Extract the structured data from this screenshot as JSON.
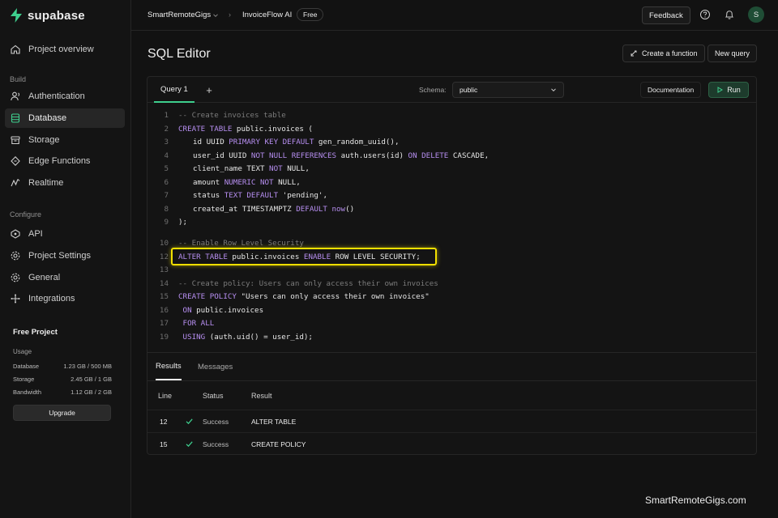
{
  "app": {
    "brand": "supabase",
    "colors": {
      "accent": "#3ecf8e",
      "highlight": "#f2e000",
      "keyword": "#b68ef0"
    }
  },
  "sidebar": {
    "top_item": {
      "label": "Project overview",
      "icon": "home-icon"
    },
    "build_section": "Build",
    "build_items": [
      {
        "label": "Authentication",
        "icon": "user-icon"
      },
      {
        "label": "Database",
        "icon": "database-icon",
        "active": true
      },
      {
        "label": "Storage",
        "icon": "archive-icon"
      },
      {
        "label": "Edge Functions",
        "icon": "code-icon"
      },
      {
        "label": "Realtime",
        "icon": "pulse-icon"
      }
    ],
    "configure_section": "Configure",
    "configure_items": [
      {
        "label": "API",
        "icon": "link-icon"
      },
      {
        "label": "Project Settings",
        "icon": "gear-icon"
      },
      {
        "label": "General",
        "icon": "settings-icon"
      },
      {
        "label": "Integrations",
        "icon": "puzzle-icon"
      }
    ],
    "usage": {
      "title": "Free Project",
      "label": "Usage",
      "rows": [
        {
          "name": "Database",
          "value": "1.23 GB / 500 MB"
        },
        {
          "name": "Storage",
          "value": "2.45 GB / 1 GB"
        },
        {
          "name": "Bandwidth",
          "value": "1.12 GB / 2 GB"
        }
      ],
      "upgrade_label": "Upgrade"
    }
  },
  "topbar": {
    "org": "SmartRemoteGigs",
    "project": "InvoiceFlow AI",
    "plan_badge": "Free",
    "feedback_label": "Feedback",
    "avatar_initial": "S"
  },
  "page": {
    "title": "SQL Editor",
    "create_function_label": "Create a function",
    "new_query_label": "New query"
  },
  "editor": {
    "tab_label": "Query 1",
    "add_tab_label": "+",
    "schema_label": "Schema:",
    "schema_value": "public",
    "documentation_label": "Documentation",
    "run_label": "Run",
    "lines": [
      {
        "n": "1",
        "tokens": [
          [
            "cm",
            "-- Create invoices table"
          ]
        ]
      },
      {
        "n": "2",
        "tokens": [
          [
            "kw",
            "CREATE TABLE"
          ],
          [
            "tx",
            " public.invoices ("
          ]
        ]
      },
      {
        "n": "3",
        "tokens": [
          [
            "tx",
            "  id UUID "
          ],
          [
            "kw",
            "PRIMARY KEY DEFAULT"
          ],
          [
            "tx",
            " gen_random_uuid(),"
          ]
        ]
      },
      {
        "n": "4",
        "tokens": [
          [
            "tx",
            "  user_id UUID "
          ],
          [
            "kw",
            "NOT NULL REFERENCES"
          ],
          [
            "tx",
            " auth.users(id) "
          ],
          [
            "kw",
            "ON DELETE"
          ],
          [
            "tx",
            " CASCADE,"
          ]
        ]
      },
      {
        "n": "5",
        "tokens": [
          [
            "tx",
            "  client_name TEXT "
          ],
          [
            "kw",
            "NOT"
          ],
          [
            "tx",
            " NULL,"
          ]
        ]
      },
      {
        "n": "6",
        "tokens": [
          [
            "tx",
            "  amount "
          ],
          [
            "kw",
            "NUMERIC NOT"
          ],
          [
            "tx",
            " NULL,"
          ]
        ]
      },
      {
        "n": "7",
        "tokens": [
          [
            "tx",
            "  status "
          ],
          [
            "kw",
            "TEXT DEFAULT"
          ],
          [
            "tx",
            " 'pending',"
          ]
        ]
      },
      {
        "n": "8",
        "tokens": [
          [
            "tx",
            "  created_at TIMESTAMPTZ "
          ],
          [
            "kw",
            "DEFAULT now"
          ],
          [
            "tx",
            "()"
          ]
        ]
      },
      {
        "n": "9",
        "tokens": [
          [
            "tx",
            ");"
          ]
        ]
      },
      {
        "n": "10",
        "tokens": [
          [
            "cm",
            "-- Enable Row Level Security"
          ]
        ]
      },
      {
        "n": "12",
        "tokens": [
          [
            "kw",
            "ALTER TABLE"
          ],
          [
            "tx",
            " public.invoices "
          ],
          [
            "kw",
            "ENABLE"
          ],
          [
            "tx",
            " ROW LEVEL SECURITY;"
          ]
        ],
        "highlighted": true
      },
      {
        "n": "13",
        "tokens": []
      },
      {
        "n": "14",
        "tokens": [
          [
            "cm",
            "-- Create policy: Users can only access their own invoices"
          ]
        ]
      },
      {
        "n": "15",
        "tokens": [
          [
            "kw",
            "CREATE POLICY"
          ],
          [
            "tx",
            " \"Users can only access their own invoices\""
          ]
        ]
      },
      {
        "n": "16",
        "tokens": [
          [
            "kw",
            " ON"
          ],
          [
            "tx",
            " public.invoices"
          ]
        ]
      },
      {
        "n": "17",
        "tokens": [
          [
            "kw",
            " FOR ALL"
          ]
        ]
      },
      {
        "n": "19",
        "tokens": [
          [
            "kw",
            " USING"
          ],
          [
            "tx",
            " (auth.uid() = user_id);"
          ]
        ]
      }
    ]
  },
  "results": {
    "tabs": [
      "Results",
      "Messages"
    ],
    "columns": [
      "Line",
      "Status",
      "Result"
    ],
    "rows": [
      {
        "line": "12",
        "status": "Success",
        "result": "ALTER TABLE"
      },
      {
        "line": "15",
        "status": "Success",
        "result": "CREATE POLICY"
      }
    ]
  },
  "watermark": "SmartRemoteGigs.com"
}
